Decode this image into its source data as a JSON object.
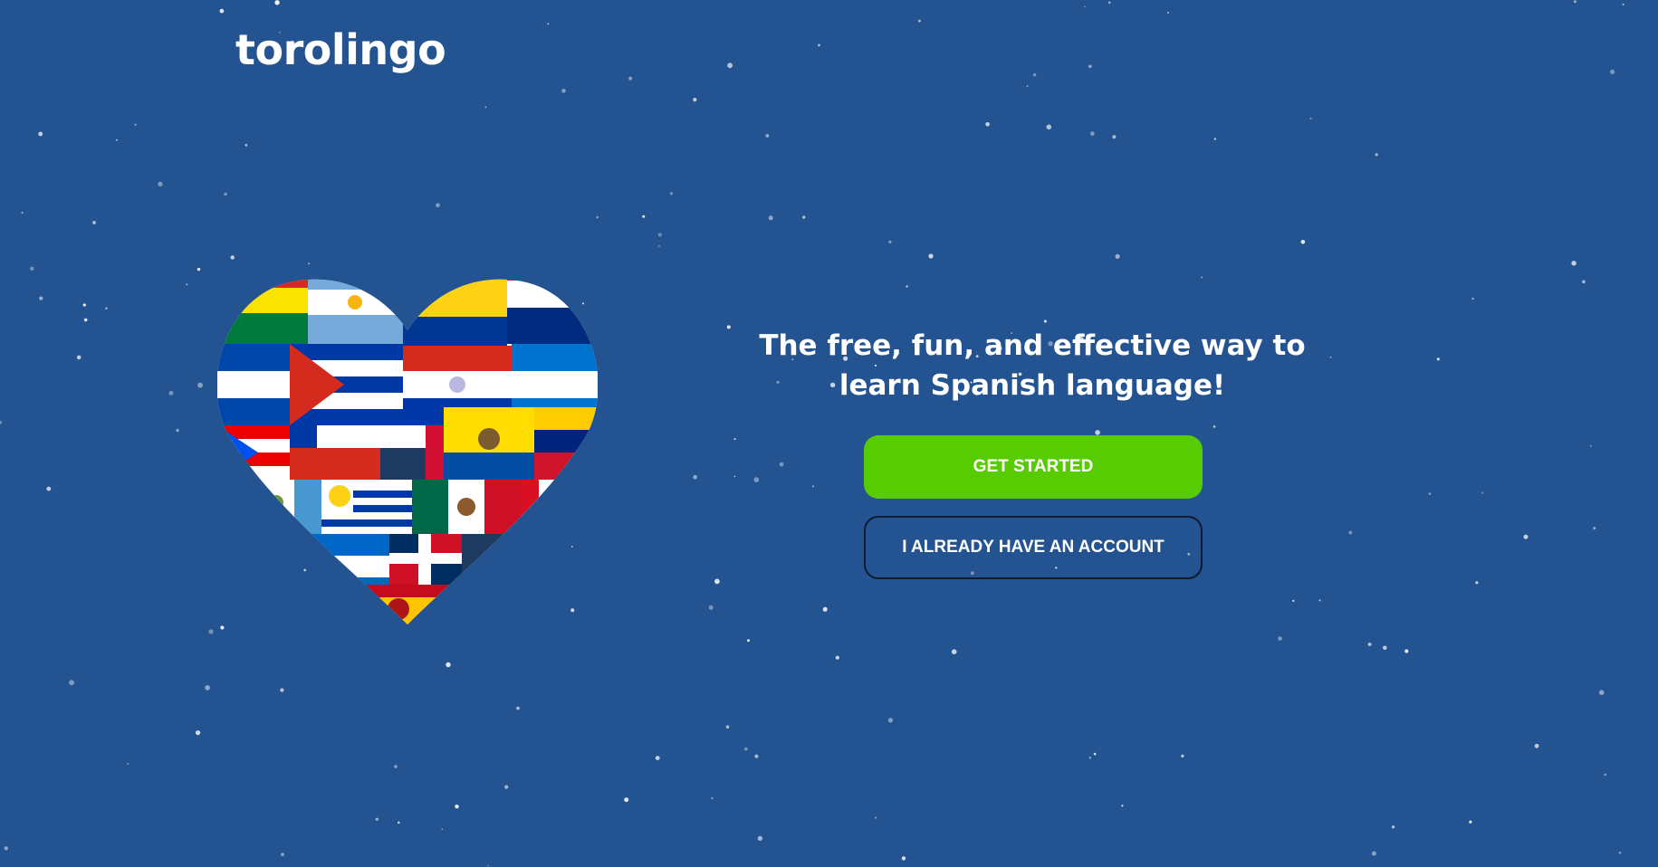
{
  "brand": {
    "name": "torolingo"
  },
  "hero": {
    "image_icon": "heart-of-spanish-speaking-country-flags",
    "headline": "The free, fun, and effective way to learn Spanish language!"
  },
  "actions": {
    "get_started": "GET STARTED",
    "login": "I ALREADY HAVE AN ACCOUNT"
  },
  "colors": {
    "background": "#235390",
    "primary_button": "#58cc02",
    "text": "#ffffff",
    "secondary_button_border": "#0d1b33"
  }
}
